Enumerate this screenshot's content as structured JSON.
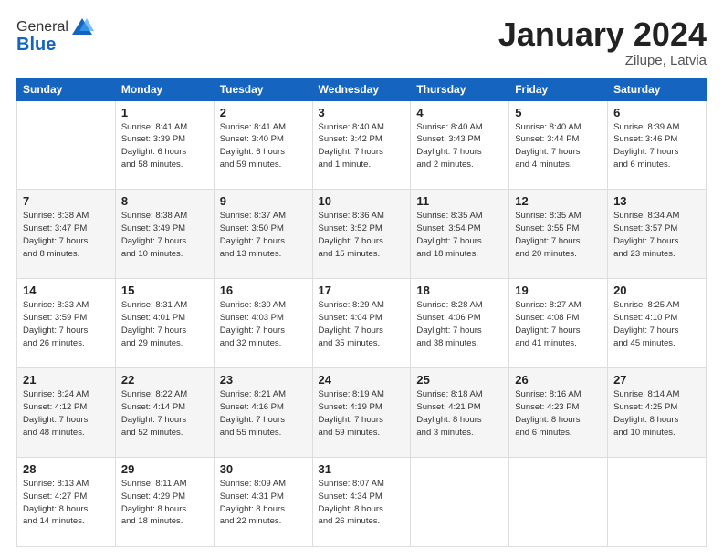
{
  "header": {
    "logo_general": "General",
    "logo_blue": "Blue",
    "month_title": "January 2024",
    "location": "Zilupe, Latvia"
  },
  "weekdays": [
    "Sunday",
    "Monday",
    "Tuesday",
    "Wednesday",
    "Thursday",
    "Friday",
    "Saturday"
  ],
  "rows": [
    [
      {
        "day": "",
        "info": ""
      },
      {
        "day": "1",
        "info": "Sunrise: 8:41 AM\nSunset: 3:39 PM\nDaylight: 6 hours\nand 58 minutes."
      },
      {
        "day": "2",
        "info": "Sunrise: 8:41 AM\nSunset: 3:40 PM\nDaylight: 6 hours\nand 59 minutes."
      },
      {
        "day": "3",
        "info": "Sunrise: 8:40 AM\nSunset: 3:42 PM\nDaylight: 7 hours\nand 1 minute."
      },
      {
        "day": "4",
        "info": "Sunrise: 8:40 AM\nSunset: 3:43 PM\nDaylight: 7 hours\nand 2 minutes."
      },
      {
        "day": "5",
        "info": "Sunrise: 8:40 AM\nSunset: 3:44 PM\nDaylight: 7 hours\nand 4 minutes."
      },
      {
        "day": "6",
        "info": "Sunrise: 8:39 AM\nSunset: 3:46 PM\nDaylight: 7 hours\nand 6 minutes."
      }
    ],
    [
      {
        "day": "7",
        "info": "Sunrise: 8:38 AM\nSunset: 3:47 PM\nDaylight: 7 hours\nand 8 minutes."
      },
      {
        "day": "8",
        "info": "Sunrise: 8:38 AM\nSunset: 3:49 PM\nDaylight: 7 hours\nand 10 minutes."
      },
      {
        "day": "9",
        "info": "Sunrise: 8:37 AM\nSunset: 3:50 PM\nDaylight: 7 hours\nand 13 minutes."
      },
      {
        "day": "10",
        "info": "Sunrise: 8:36 AM\nSunset: 3:52 PM\nDaylight: 7 hours\nand 15 minutes."
      },
      {
        "day": "11",
        "info": "Sunrise: 8:35 AM\nSunset: 3:54 PM\nDaylight: 7 hours\nand 18 minutes."
      },
      {
        "day": "12",
        "info": "Sunrise: 8:35 AM\nSunset: 3:55 PM\nDaylight: 7 hours\nand 20 minutes."
      },
      {
        "day": "13",
        "info": "Sunrise: 8:34 AM\nSunset: 3:57 PM\nDaylight: 7 hours\nand 23 minutes."
      }
    ],
    [
      {
        "day": "14",
        "info": "Sunrise: 8:33 AM\nSunset: 3:59 PM\nDaylight: 7 hours\nand 26 minutes."
      },
      {
        "day": "15",
        "info": "Sunrise: 8:31 AM\nSunset: 4:01 PM\nDaylight: 7 hours\nand 29 minutes."
      },
      {
        "day": "16",
        "info": "Sunrise: 8:30 AM\nSunset: 4:03 PM\nDaylight: 7 hours\nand 32 minutes."
      },
      {
        "day": "17",
        "info": "Sunrise: 8:29 AM\nSunset: 4:04 PM\nDaylight: 7 hours\nand 35 minutes."
      },
      {
        "day": "18",
        "info": "Sunrise: 8:28 AM\nSunset: 4:06 PM\nDaylight: 7 hours\nand 38 minutes."
      },
      {
        "day": "19",
        "info": "Sunrise: 8:27 AM\nSunset: 4:08 PM\nDaylight: 7 hours\nand 41 minutes."
      },
      {
        "day": "20",
        "info": "Sunrise: 8:25 AM\nSunset: 4:10 PM\nDaylight: 7 hours\nand 45 minutes."
      }
    ],
    [
      {
        "day": "21",
        "info": "Sunrise: 8:24 AM\nSunset: 4:12 PM\nDaylight: 7 hours\nand 48 minutes."
      },
      {
        "day": "22",
        "info": "Sunrise: 8:22 AM\nSunset: 4:14 PM\nDaylight: 7 hours\nand 52 minutes."
      },
      {
        "day": "23",
        "info": "Sunrise: 8:21 AM\nSunset: 4:16 PM\nDaylight: 7 hours\nand 55 minutes."
      },
      {
        "day": "24",
        "info": "Sunrise: 8:19 AM\nSunset: 4:19 PM\nDaylight: 7 hours\nand 59 minutes."
      },
      {
        "day": "25",
        "info": "Sunrise: 8:18 AM\nSunset: 4:21 PM\nDaylight: 8 hours\nand 3 minutes."
      },
      {
        "day": "26",
        "info": "Sunrise: 8:16 AM\nSunset: 4:23 PM\nDaylight: 8 hours\nand 6 minutes."
      },
      {
        "day": "27",
        "info": "Sunrise: 8:14 AM\nSunset: 4:25 PM\nDaylight: 8 hours\nand 10 minutes."
      }
    ],
    [
      {
        "day": "28",
        "info": "Sunrise: 8:13 AM\nSunset: 4:27 PM\nDaylight: 8 hours\nand 14 minutes."
      },
      {
        "day": "29",
        "info": "Sunrise: 8:11 AM\nSunset: 4:29 PM\nDaylight: 8 hours\nand 18 minutes."
      },
      {
        "day": "30",
        "info": "Sunrise: 8:09 AM\nSunset: 4:31 PM\nDaylight: 8 hours\nand 22 minutes."
      },
      {
        "day": "31",
        "info": "Sunrise: 8:07 AM\nSunset: 4:34 PM\nDaylight: 8 hours\nand 26 minutes."
      },
      {
        "day": "",
        "info": ""
      },
      {
        "day": "",
        "info": ""
      },
      {
        "day": "",
        "info": ""
      }
    ]
  ]
}
